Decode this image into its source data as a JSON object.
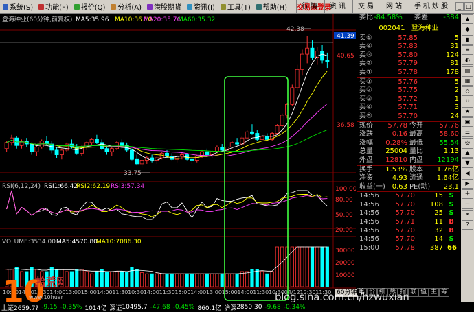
{
  "menubar": {
    "items": [
      {
        "label": "系统(S)",
        "color": "#3060c0"
      },
      {
        "label": "功能(F)",
        "color": "#c03030"
      },
      {
        "label": "报价(Q)",
        "color": "#30a030"
      },
      {
        "label": "分析(A)",
        "color": "#c08030"
      },
      {
        "label": "港股期货",
        "color": "#8030c0"
      },
      {
        "label": "资讯(I)",
        "color": "#3090c0"
      },
      {
        "label": "工具(T)",
        "color": "#909030"
      },
      {
        "label": "帮助(H)",
        "color": "#307070"
      }
    ],
    "trade_label": "交易未登录",
    "right_buttons": [
      "行情",
      "资讯",
      "交易",
      "网站",
      "手机炒股"
    ]
  },
  "chart_header": {
    "main": {
      "name": "登海种业(60分钟,前复权)",
      "ma5": "MA5:35.96",
      "ma10": "MA10:36.10",
      "ma20": "MA20:35.76",
      "ma60": "MA60:35.32"
    },
    "rsi": {
      "name": "RSI(6,12,24)",
      "rsi1": "RSI1:66.42",
      "rsi2": "RSI2:62.19",
      "rsi3": "RSI3:57.34"
    },
    "vol": {
      "name": "VOLUME:3534.00",
      "ma5": "MA5:4570.80",
      "ma10": "MA10:7086.30"
    }
  },
  "chart_data": {
    "type": "candlestick",
    "period": "60分钟",
    "y_axis_main": [
      "41.39",
      "40.65",
      "36.58"
    ],
    "max_label": "42.38",
    "min_label": "33.75",
    "y_axis_rsi": [
      "100.00",
      "80.00",
      "50.00",
      "20.00"
    ],
    "y_axis_vol": [
      "30000",
      "20000",
      "10000"
    ],
    "x_ticks": [
      "10:30",
      "14:00",
      "11:30",
      "14:00",
      "13:00",
      "15:00",
      "14:00",
      "11:30",
      "10:30",
      "14:00",
      "11:30",
      "15:00",
      "14:00",
      "13:00",
      "15:00",
      "14:00",
      "11:30",
      "10:30",
      "04/12",
      "10:30",
      "11:30"
    ],
    "candles": [
      [
        35.0,
        35.5,
        34.8,
        35.4
      ],
      [
        35.4,
        35.9,
        35.2,
        35.7
      ],
      [
        35.7,
        35.8,
        35.0,
        35.2
      ],
      [
        35.2,
        35.6,
        35.0,
        35.5
      ],
      [
        35.5,
        35.7,
        35.1,
        35.3
      ],
      [
        35.3,
        35.4,
        34.6,
        34.8
      ],
      [
        34.8,
        35.2,
        34.5,
        35.1
      ],
      [
        35.1,
        35.6,
        35.0,
        35.5
      ],
      [
        35.5,
        35.8,
        35.2,
        35.3
      ],
      [
        35.3,
        35.5,
        34.7,
        34.9
      ],
      [
        34.9,
        35.1,
        34.4,
        34.6
      ],
      [
        34.6,
        35.0,
        34.3,
        34.9
      ],
      [
        34.9,
        35.4,
        34.8,
        35.3
      ],
      [
        35.3,
        35.6,
        35.0,
        35.1
      ],
      [
        35.1,
        35.3,
        34.6,
        34.7
      ],
      [
        34.7,
        35.2,
        34.5,
        35.1
      ],
      [
        35.1,
        35.5,
        34.9,
        35.4
      ],
      [
        35.4,
        35.7,
        35.2,
        35.6
      ],
      [
        35.6,
        35.9,
        35.3,
        35.4
      ],
      [
        35.4,
        35.6,
        34.9,
        35.0
      ],
      [
        35.0,
        35.2,
        34.6,
        34.8
      ],
      [
        34.8,
        35.1,
        34.5,
        35.0
      ],
      [
        35.0,
        35.5,
        34.9,
        35.4
      ],
      [
        35.4,
        35.6,
        35.0,
        35.2
      ],
      [
        35.2,
        35.4,
        34.8,
        34.9
      ],
      [
        34.9,
        35.0,
        34.2,
        34.3
      ],
      [
        34.3,
        34.6,
        33.9,
        34.0
      ],
      [
        34.0,
        34.3,
        33.75,
        34.2
      ],
      [
        34.2,
        34.5,
        34.0,
        34.4
      ],
      [
        34.4,
        34.6,
        34.1,
        34.2
      ],
      [
        34.2,
        34.5,
        34.0,
        34.4
      ],
      [
        34.4,
        34.8,
        34.3,
        34.7
      ],
      [
        34.7,
        34.9,
        34.4,
        34.5
      ],
      [
        34.5,
        34.7,
        34.2,
        34.3
      ],
      [
        34.3,
        34.6,
        34.1,
        34.5
      ],
      [
        34.5,
        34.8,
        34.3,
        34.6
      ],
      [
        34.6,
        34.7,
        34.2,
        34.3
      ],
      [
        34.3,
        34.5,
        34.0,
        34.2
      ],
      [
        34.2,
        34.6,
        34.1,
        34.5
      ],
      [
        34.5,
        34.9,
        34.4,
        34.8
      ],
      [
        34.8,
        35.0,
        34.5,
        34.6
      ],
      [
        34.6,
        34.9,
        34.4,
        34.8
      ],
      [
        34.8,
        35.2,
        34.7,
        35.1
      ],
      [
        35.1,
        35.3,
        34.8,
        34.9
      ],
      [
        34.9,
        35.2,
        34.7,
        35.1
      ],
      [
        35.1,
        35.5,
        35.0,
        35.4
      ],
      [
        35.4,
        35.7,
        35.2,
        35.3
      ],
      [
        35.3,
        35.8,
        35.2,
        35.7
      ],
      [
        35.7,
        36.2,
        35.6,
        36.1
      ],
      [
        36.1,
        36.6,
        35.9,
        36.0
      ],
      [
        36.0,
        36.2,
        35.5,
        35.6
      ],
      [
        35.6,
        35.9,
        35.3,
        35.8
      ],
      [
        35.8,
        36.0,
        35.5,
        35.6
      ],
      [
        35.6,
        36.1,
        35.5,
        36.0
      ],
      [
        36.0,
        36.6,
        35.9,
        36.5
      ],
      [
        36.5,
        37.3,
        36.4,
        37.2
      ],
      [
        37.2,
        38.0,
        37.0,
        37.9
      ],
      [
        37.9,
        39.2,
        37.8,
        39.0
      ],
      [
        39.0,
        40.5,
        38.8,
        40.2
      ],
      [
        40.2,
        41.5,
        39.8,
        41.2
      ],
      [
        41.2,
        42.38,
        40.6,
        41.6
      ],
      [
        41.6,
        42.1,
        40.8,
        41.0
      ],
      [
        41.0,
        41.7,
        40.5,
        41.4
      ],
      [
        41.4,
        41.8,
        40.6,
        40.8
      ],
      [
        40.8,
        41.3,
        40.3,
        40.7
      ]
    ]
  },
  "panel": {
    "webi_label": "委比",
    "webi_value": "-84.58%",
    "weicha_label": "委差",
    "weicha_value": "-384",
    "code": "002041",
    "name": "登海种业",
    "sell": [
      {
        "label": "卖⑤",
        "price": "57.85",
        "vol": "5"
      },
      {
        "label": "卖④",
        "price": "57.83",
        "vol": "31"
      },
      {
        "label": "卖③",
        "price": "57.80",
        "vol": "124"
      },
      {
        "label": "卖②",
        "price": "57.79",
        "vol": "81"
      },
      {
        "label": "卖①",
        "price": "57.78",
        "vol": "178"
      }
    ],
    "buy": [
      {
        "label": "买①",
        "price": "57.76",
        "vol": "5"
      },
      {
        "label": "买②",
        "price": "57.75",
        "vol": "2"
      },
      {
        "label": "买③",
        "price": "57.72",
        "vol": "1"
      },
      {
        "label": "买④",
        "price": "57.71",
        "vol": "3"
      },
      {
        "label": "买⑤",
        "price": "57.70",
        "vol": "24"
      }
    ],
    "stats": [
      {
        "l1": "现价",
        "v1": "57.78",
        "c1": "red",
        "l2": "今开",
        "v2": "57.76",
        "c2": "red"
      },
      {
        "l1": "涨跌",
        "v1": "0.16",
        "c1": "red",
        "l2": "最高",
        "v2": "58.60",
        "c2": "red"
      },
      {
        "l1": "涨幅",
        "v1": "0.28%",
        "c1": "red",
        "l2": "最低",
        "v2": "55.54",
        "c2": "green"
      },
      {
        "l1": "总量",
        "v1": "25004",
        "c1": "yellow",
        "l2": "量比",
        "v2": "1.13",
        "c2": "yellow"
      },
      {
        "l1": "外盘",
        "v1": "12810",
        "c1": "red",
        "l2": "内盘",
        "v2": "12194",
        "c2": "green"
      }
    ],
    "stats2": [
      {
        "l1": "换手",
        "v1": "1.53%",
        "l2": "股本",
        "v2": "1.76亿"
      },
      {
        "l1": "净资",
        "v1": "4.93",
        "l2": "流通",
        "v2": "1.64亿"
      },
      {
        "l1": "收益(一)",
        "v1": "0.63",
        "l2": "PE(动)",
        "v2": "23.1"
      }
    ],
    "ticks": [
      {
        "time": "14:56",
        "price": "57.70",
        "vol": "15",
        "bs": "S"
      },
      {
        "time": "14:56",
        "price": "57.70",
        "vol": "108",
        "bs": "S"
      },
      {
        "time": "14:56",
        "price": "57.70",
        "vol": "25",
        "bs": "S"
      },
      {
        "time": "14:56",
        "price": "57.71",
        "vol": "11",
        "bs": "B"
      },
      {
        "time": "14:56",
        "price": "57.70",
        "vol": "32",
        "bs": "B"
      },
      {
        "time": "14:56",
        "price": "57.70",
        "vol": "14",
        "bs": "S"
      },
      {
        "time": "15:00",
        "price": "57.78",
        "vol": "387",
        "bs": "66"
      }
    ]
  },
  "tabs": [
    "笔",
    "价",
    "细",
    "势",
    "指",
    "联",
    "值",
    "主",
    "筹"
  ],
  "period_tab": "60分钟",
  "statusbar": {
    "sh": "上证2659.7?",
    "sh_chg": "-9.15",
    "sh_pct": "-0.35%",
    "sh_amt": "1014亿",
    "sz_label": "深证",
    "sz_val": "10495.7",
    "sz_chg": "-47.68",
    "sz_pct": "-0.45%",
    "sz_amt": "860.1亿",
    "hs_label": "沪深",
    "hs_val": "2850.30",
    "hs_chg": "-9.68",
    "hs_pct": "-0.34%"
  },
  "watermark": {
    "logo_num": "10",
    "logo_text": "拾荒网",
    "logo_url": "www.10huang.CN",
    "site": "blog.sina.com.cn/hzwuxian"
  }
}
